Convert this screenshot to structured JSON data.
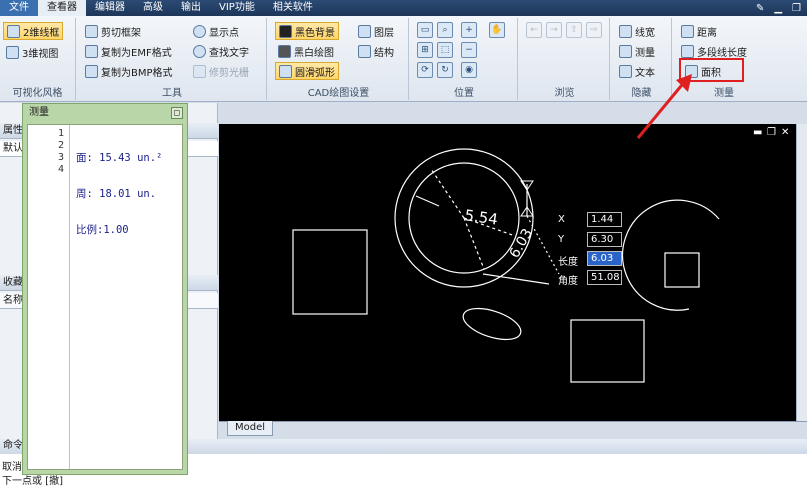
{
  "menu": {
    "items": [
      "文件",
      "查看器",
      "编辑器",
      "高级",
      "输出",
      "VIP功能",
      "相关软件"
    ]
  },
  "ribbon": {
    "view_style": {
      "btn_2d": "2维线框",
      "btn_3d": "3维视图",
      "label": "可视化风格"
    },
    "tools": {
      "clip_frame": "剪切框架",
      "copy_emf": "复制为EMF格式",
      "copy_bmp": "复制为BMP格式",
      "show_points": "显示点",
      "find_text": "查找文字",
      "trim_raster": "修剪光栅",
      "label": "工具"
    },
    "cad": {
      "black_bg": "黑色背景",
      "bw_draw": "黑白绘图",
      "smooth_arc": "圆滑弧形",
      "layers": "图层",
      "structure": "结构",
      "label": "CAD绘图设置"
    },
    "position": {
      "label": "位置"
    },
    "browse": {
      "label": "浏览"
    },
    "hide": {
      "linewidth": "线宽",
      "measure": "测量",
      "text": "文本",
      "label": "隐藏"
    },
    "measure": {
      "distance": "距离",
      "polyline_length": "多段线长度",
      "area": "面积",
      "label": "测量"
    }
  },
  "left_panel": {
    "props_header": "属性",
    "default_field": "默认",
    "favorites_header": "收藏",
    "name_col": "名称"
  },
  "measure_window": {
    "title": "测量",
    "line_numbers": [
      "1",
      "2",
      "3",
      "4"
    ],
    "lines": [
      "面: 15.43 un.²",
      "周: 18.01 un.",
      "比例:1.00",
      ""
    ]
  },
  "canvas": {
    "dimension_label": "5.54",
    "dimension_label2": "6.03",
    "popup": {
      "x_label": "X",
      "x_value": "1.44",
      "y_label": "Y",
      "y_value": "6.30",
      "len_label": "长度",
      "len_value": "6.03",
      "angle_label": "角度",
      "angle_value": "51.08"
    },
    "model_tab": "Model"
  },
  "command": {
    "header": "命令",
    "line1": "取消",
    "line2": "下一点或 [撤]"
  },
  "colors": {
    "canvas_bg": "#000000",
    "accent_red": "#e02020",
    "float_window": "#b9d6a8"
  }
}
